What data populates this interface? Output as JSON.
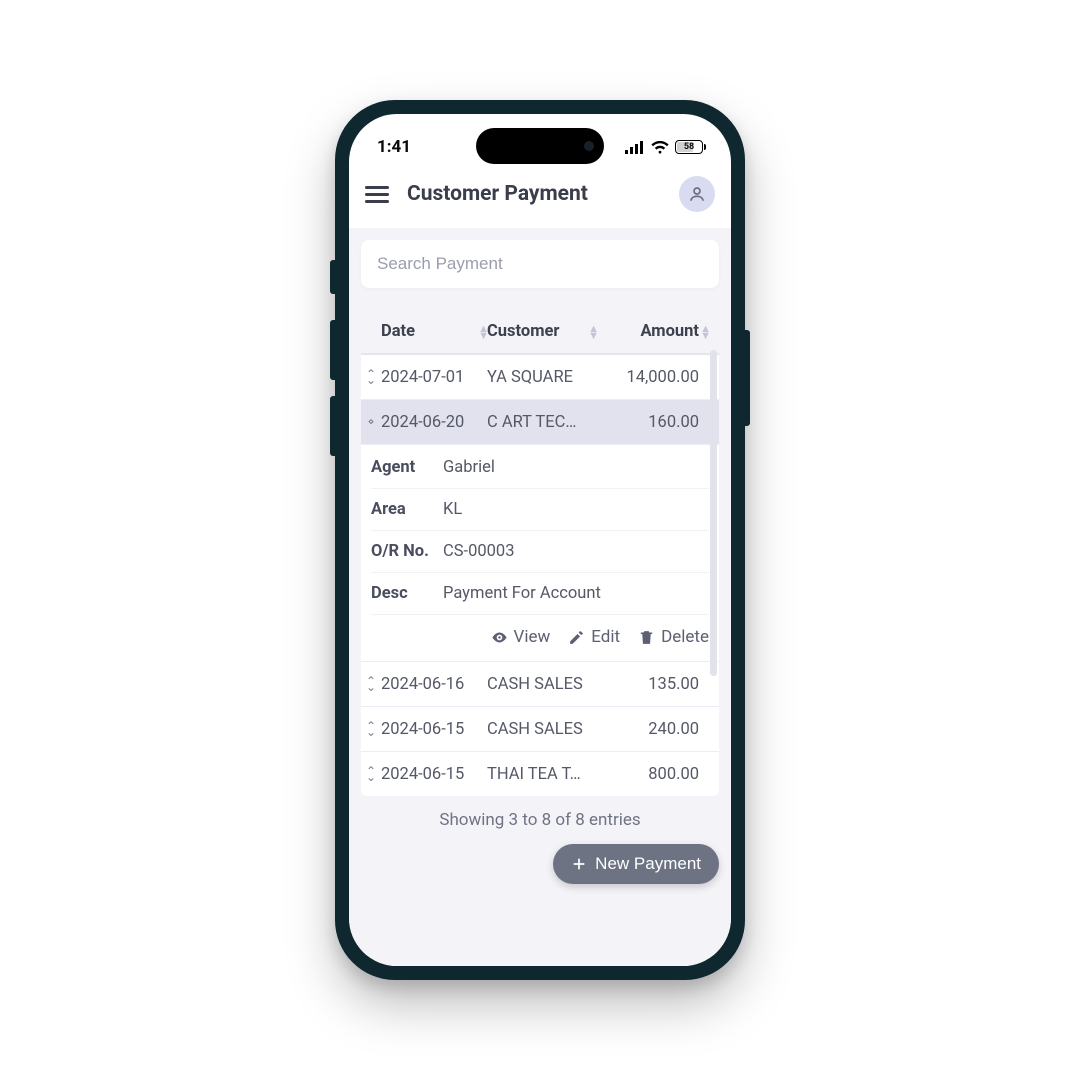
{
  "status": {
    "time": "1:41",
    "battery": "58"
  },
  "header": {
    "title": "Customer Payment"
  },
  "search": {
    "placeholder": "Search Payment"
  },
  "table": {
    "columns": {
      "date": "Date",
      "customer": "Customer",
      "amount": "Amount"
    },
    "rows": [
      {
        "date": "2024-07-01",
        "customer": "YA SQUARE",
        "amount": "14,000.00",
        "expanded": false
      },
      {
        "date": "2024-06-20",
        "customer": "C ART TEC…",
        "amount": "160.00",
        "expanded": true,
        "detail": {
          "agent_label": "Agent",
          "agent": "Gabriel",
          "area_label": "Area",
          "area": "KL",
          "orno_label": "O/R No.",
          "orno": "CS-00003",
          "desc_label": "Desc",
          "desc": "Payment For Account"
        }
      },
      {
        "date": "2024-06-16",
        "customer": "CASH SALES",
        "amount": "135.00",
        "expanded": false
      },
      {
        "date": "2024-06-15",
        "customer": "CASH SALES",
        "amount": "240.00",
        "expanded": false
      },
      {
        "date": "2024-06-15",
        "customer": "THAI TEA T…",
        "amount": "800.00",
        "expanded": false
      }
    ]
  },
  "actions": {
    "view": "View",
    "edit": "Edit",
    "delete": "Delete"
  },
  "pager": "Showing 3 to 8 of 8 entries",
  "fab": {
    "label": "New Payment"
  }
}
